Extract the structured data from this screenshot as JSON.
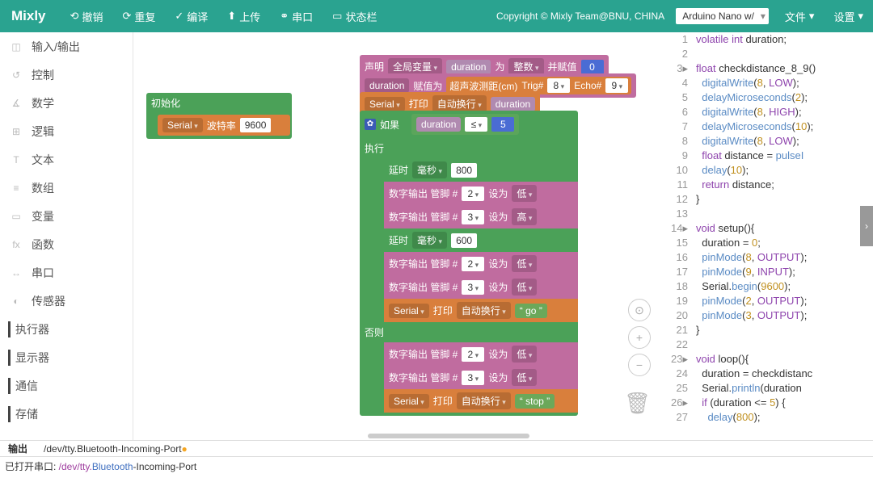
{
  "header": {
    "logo": "Mixly",
    "undo": "撤销",
    "redo": "重复",
    "compile": "编译",
    "upload": "上传",
    "serial": "串口",
    "status": "状态栏",
    "copyright": "Copyright © Mixly Team@BNU, CHINA",
    "board": "Arduino Nano w/",
    "file": "文件",
    "settings": "设置"
  },
  "categories": [
    {
      "label": "输入/输出",
      "ico": "◫"
    },
    {
      "label": "控制",
      "ico": "↺"
    },
    {
      "label": "数学",
      "ico": "∡"
    },
    {
      "label": "逻辑",
      "ico": "⊞"
    },
    {
      "label": "文本",
      "ico": "T"
    },
    {
      "label": "数组",
      "ico": "≡"
    },
    {
      "label": "变量",
      "ico": "▭"
    },
    {
      "label": "函数",
      "ico": "fx"
    },
    {
      "label": "串口",
      "ico": "↔"
    },
    {
      "label": "传感器",
      "ico": "◐"
    },
    {
      "label": "执行器",
      "ico": "▶",
      "col": true,
      "color": "#444"
    },
    {
      "label": "显示器",
      "ico": "▶",
      "col": true,
      "color": "#444"
    },
    {
      "label": "通信",
      "ico": "▶",
      "col": true,
      "color": "#444"
    },
    {
      "label": "存储",
      "ico": "▶",
      "col": true,
      "color": "#444"
    }
  ],
  "blocks": {
    "init": {
      "title": "初始化",
      "serial": "Serial",
      "baud": "波特率",
      "rate": "9600"
    },
    "decl": {
      "scope": "声明",
      "va": "全局变量",
      "name": "duration",
      "as": "为",
      "type": "整数",
      "assign": "并赋值",
      "val": "0"
    },
    "set": {
      "name": "duration",
      "lbl": "赋值为",
      "ultra": "超声波测距(cm)",
      "trig": "Trig#",
      "trigp": "8",
      "echo": "Echo#",
      "echop": "9"
    },
    "print": {
      "s": "Serial",
      "p": "打印",
      "m": "自动换行",
      "v": "duration"
    },
    "if": {
      "kw": "如果",
      "v": "duration",
      "op": "≤",
      "n": "5",
      "exec": "执行",
      "else": "否则"
    },
    "delay": {
      "lbl": "延时",
      "unit": "毫秒",
      "v1": "800",
      "v2": "600"
    },
    "pin": {
      "lbl": "数字输出 管脚 #",
      "p2": "2",
      "p3": "3",
      "set": "设为",
      "low": "低",
      "high": "高"
    },
    "go": "go",
    "stop": "stop"
  },
  "code": {
    "lines": [
      "volatile int duration;",
      "",
      "float checkdistance_8_9()",
      "  digitalWrite(8, LOW);",
      "  delayMicroseconds(2);",
      "  digitalWrite(8, HIGH);",
      "  delayMicroseconds(10);",
      "  digitalWrite(8, LOW);",
      "  float distance = pulseI",
      "  delay(10);",
      "  return distance;",
      "}",
      "",
      "void setup(){",
      "  duration = 0;",
      "  pinMode(8, OUTPUT);",
      "  pinMode(9, INPUT);",
      "  Serial.begin(9600);",
      "  pinMode(2, OUTPUT);",
      "  pinMode(3, OUTPUT);",
      "}",
      "",
      "void loop(){",
      "  duration = checkdistanc",
      "  Serial.println(duration",
      "  if (duration <= 5) {",
      "    delay(800);"
    ]
  },
  "tabs": {
    "output": "输出",
    "port": "/dev/tty.Bluetooth-Incoming-Port"
  },
  "console": {
    "pre": "已打开串口: ",
    "p1": "/dev/tty.",
    "p2": "Bluetooth",
    "p3": "-Incoming-Port"
  }
}
